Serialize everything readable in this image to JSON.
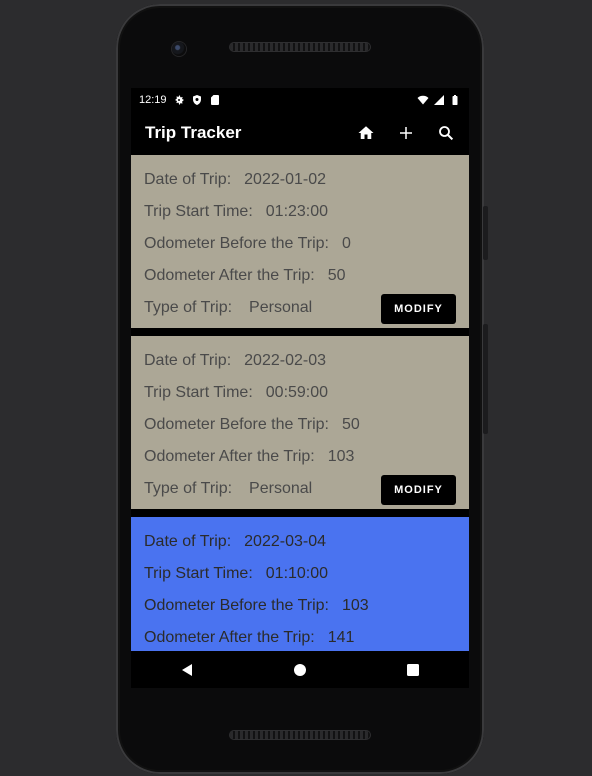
{
  "status_bar": {
    "time": "12:19",
    "left_icons": [
      "gear-icon",
      "shield-icon",
      "sd-card-icon"
    ],
    "right_icons": [
      "wifi-icon",
      "signal-icon",
      "battery-icon"
    ]
  },
  "app_bar": {
    "title": "Trip Tracker",
    "actions": [
      "home-icon",
      "plus-icon",
      "search-icon"
    ]
  },
  "labels": {
    "date": "Date of Trip:",
    "start_time": "Trip Start Time:",
    "odo_before": "Odometer Before the Trip:",
    "odo_after": "Odometer After the Trip:",
    "type": "Type of Trip:",
    "modify": "MODIFY"
  },
  "trips": [
    {
      "date": "2022-01-02",
      "start_time": "01:23:00",
      "odo_before": "0",
      "odo_after": "50",
      "type": "Personal",
      "color": "#aca796"
    },
    {
      "date": "2022-02-03",
      "start_time": "00:59:00",
      "odo_before": "50",
      "odo_after": "103",
      "type": "Personal",
      "color": "#aca796"
    },
    {
      "date": "2022-03-04",
      "start_time": "01:10:00",
      "odo_before": "103",
      "odo_after": "141",
      "color": "#4a73f0"
    }
  ],
  "nav_bar": [
    "back-icon",
    "home-circle-icon",
    "recents-icon"
  ]
}
